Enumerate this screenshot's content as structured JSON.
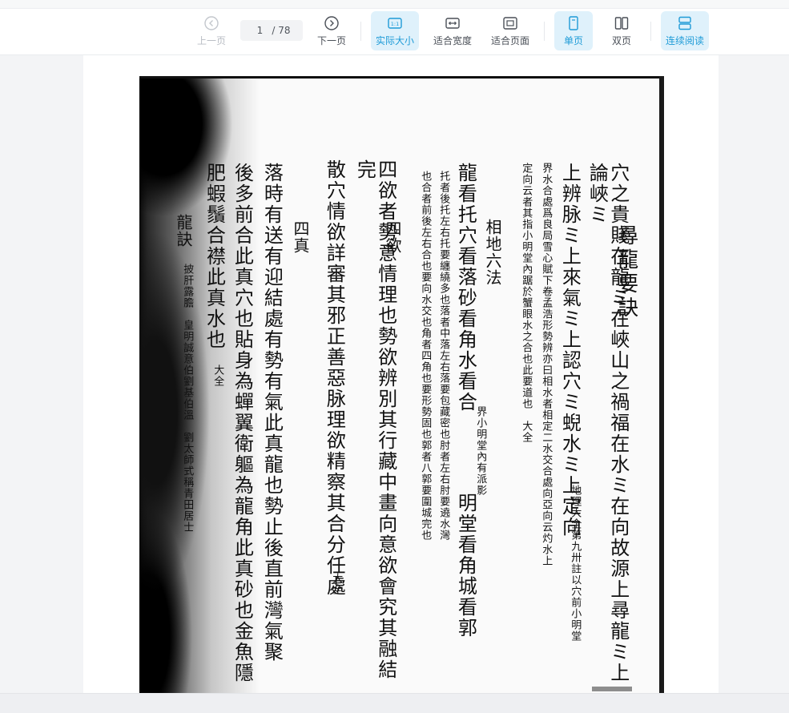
{
  "toolbar": {
    "prev_label": "上一页",
    "current_page": "1",
    "total_pages": "/ 78",
    "next_label": "下一页",
    "actual_size_label": "实际大小",
    "fit_width_label": "适合宽度",
    "fit_page_label": "适合页面",
    "single_page_label": "单页",
    "double_page_label": "双页",
    "continuous_label": "连续阅读",
    "accent_color": "#1e9bd7"
  },
  "document": {
    "columns": [
      {
        "kind": "title",
        "text": "尋龍要訣"
      },
      {
        "kind": "big",
        "text": "穴之貴賤在龍ミ在峽山之禍福在水ミ在向故源上尋龍ミ上論峽ミ"
      },
      {
        "kind": "big",
        "text": "上辨脉ミ上來氣ミ上認穴ミ蜺水ミ上定向"
      },
      {
        "kind": "small",
        "text": "地理大全第九卅註以穴前小明堂"
      },
      {
        "kind": "small",
        "text": "界水合處爲良局雪心賦下卷孟浩形勢辨亦曰相水者相定二水交合處向亞向云灼水上"
      },
      {
        "kind": "small",
        "text": "定向云者其指小明堂內踞於蟹眼水之合也此要道也　大全"
      },
      {
        "kind": "mid",
        "text": "相地六法"
      },
      {
        "kind": "big",
        "text": "龍看托穴看落砂看角水看合"
      },
      {
        "kind": "small",
        "text": "界小明堂內有派影"
      },
      {
        "kind": "big",
        "text": "明堂看角城看郭"
      },
      {
        "kind": "small",
        "text": "托者後托左右托要纏繞多也落者中落左右落要包藏密也肘者左右肘要遶水灣"
      },
      {
        "kind": "small",
        "text": "也合者前後左右合也要向水交也角者四角也要形勢固也郭者八郭要圍城完也"
      },
      {
        "kind": "mid",
        "text": "四欲"
      },
      {
        "kind": "big",
        "text": "四欲者勢意情理也勢欲辨別其行藏中畫向意欲會究其融結完"
      },
      {
        "kind": "big",
        "text": "散穴情欲詳審其邪正善惡脉理欲精察其合分任處"
      },
      {
        "kind": "small",
        "text": "大全"
      },
      {
        "kind": "mid",
        "text": "四真"
      },
      {
        "kind": "big",
        "text": "落時有送有迎結處有勢有氣此真龍也勢止後直前灣氣聚"
      },
      {
        "kind": "big",
        "text": "後多前合此真穴也貼身為蟬翼衛軀為龍角此真砂也金魚隱"
      },
      {
        "kind": "big",
        "text": "肥蝦鬚合襟此真水也"
      },
      {
        "kind": "small",
        "text": "大全"
      },
      {
        "kind": "mid",
        "text": "龍訣"
      },
      {
        "kind": "small",
        "text": "披肝露膽　皇明誠意伯劉基伯溫　劉太師式稱青田居士"
      }
    ]
  }
}
